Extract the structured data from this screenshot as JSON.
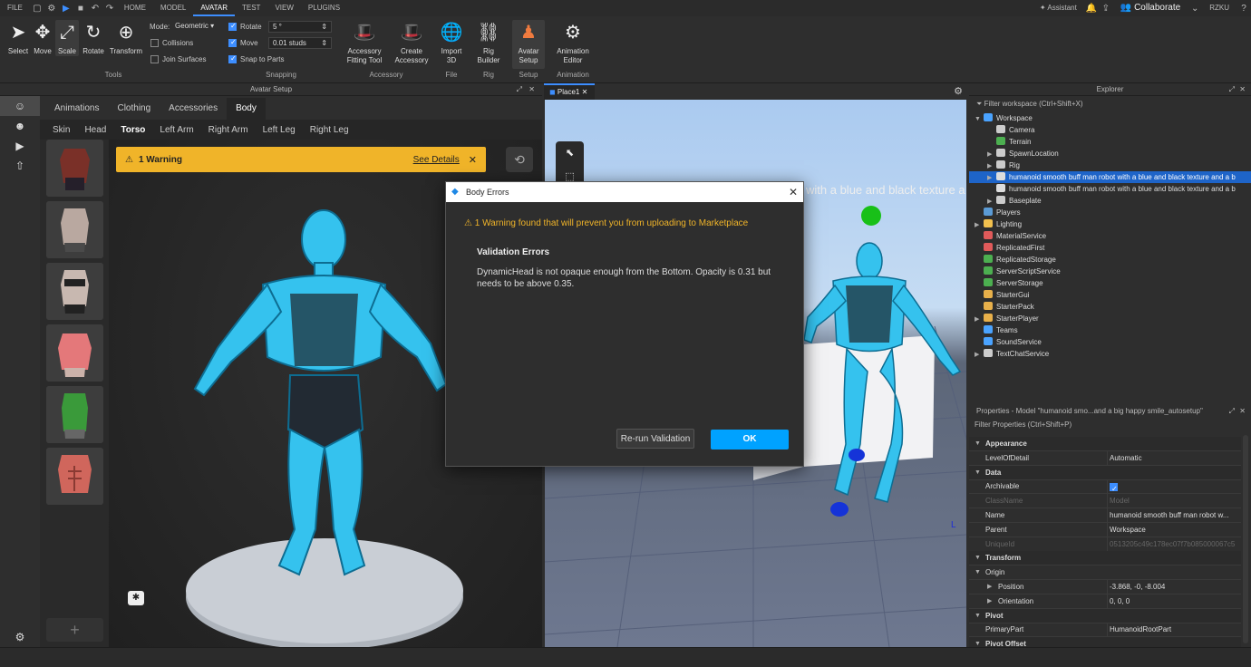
{
  "menu": {
    "file": "FILE",
    "tabs": [
      "HOME",
      "MODEL",
      "AVATAR",
      "TEST",
      "VIEW",
      "PLUGINS"
    ],
    "active_tab": "AVATAR",
    "assistant": "Assistant",
    "collaborate": "Collaborate",
    "user": "RZKU"
  },
  "ribbon": {
    "tools": {
      "select": "Select",
      "move": "Move",
      "scale": "Scale",
      "rotate": "Rotate",
      "transform": "Transform",
      "group": "Tools"
    },
    "mode_label": "Mode:",
    "mode_value": "Geometric",
    "collisions": "Collisions",
    "join_surfaces": "Join Surfaces",
    "rotate_label": "Rotate",
    "rotate_value": "5 °",
    "move_label": "Move",
    "move_value": "0.01 studs",
    "snap_to_parts": "Snap to Parts",
    "snapping_group": "Snapping",
    "accessory_fitting": [
      "Accessory",
      "Fitting Tool"
    ],
    "create_accessory": [
      "Create",
      "Accessory"
    ],
    "accessory_group": "Accessory",
    "import_3d": [
      "Import",
      "3D"
    ],
    "file_group": "File",
    "rig_builder": [
      "Rig",
      "Builder"
    ],
    "rig_group": "Rig",
    "avatar_setup": [
      "Avatar",
      "Setup"
    ],
    "setup_group": "Setup",
    "animation_editor": [
      "Animation",
      "Editor"
    ],
    "animation_group": "Animation"
  },
  "avatar_panel": {
    "title": "Avatar Setup",
    "tabs": [
      "Animations",
      "Clothing",
      "Accessories",
      "Body"
    ],
    "active_tab": "Body",
    "subtabs": [
      "Skin",
      "Head",
      "Torso",
      "Left Arm",
      "Right Arm",
      "Left Leg",
      "Right Leg"
    ],
    "active_subtab": "Torso",
    "warning": "1 Warning",
    "see_details": "See Details",
    "add": "+"
  },
  "viewport": {
    "tab": "Place1",
    "overlay_text": "with a blue and black texture a"
  },
  "dialog": {
    "title": "Body Errors",
    "warning": "1 Warning found that will prevent you from uploading to Marketplace",
    "heading": "Validation Errors",
    "message": "DynamicHead is not opaque enough from the Bottom. Opacity is 0.31 but needs to be above 0.35.",
    "rerun": "Re-run Validation",
    "ok": "OK"
  },
  "explorer": {
    "title": "Explorer",
    "filter": "Filter workspace (Ctrl+Shift+X)",
    "items": [
      {
        "label": "Workspace",
        "depth": 0,
        "arrow": "▼",
        "color": "#4aa3ff"
      },
      {
        "label": "Camera",
        "depth": 1,
        "arrow": "",
        "color": "#cccccc"
      },
      {
        "label": "Terrain",
        "depth": 1,
        "arrow": "",
        "color": "#4caf50"
      },
      {
        "label": "SpawnLocation",
        "depth": 1,
        "arrow": "▶",
        "color": "#cccccc"
      },
      {
        "label": "Rig",
        "depth": 1,
        "arrow": "▶",
        "color": "#cccccc"
      },
      {
        "label": "humanoid smooth buff man robot with a blue and black texture and a b",
        "depth": 1,
        "arrow": "▶",
        "color": "#dddddd",
        "selected": true
      },
      {
        "label": "humanoid smooth buff man robot with a blue and black texture and a b",
        "depth": 1,
        "arrow": "",
        "color": "#dddddd"
      },
      {
        "label": "Baseplate",
        "depth": 1,
        "arrow": "▶",
        "color": "#cccccc"
      },
      {
        "label": "Players",
        "depth": 0,
        "arrow": "",
        "color": "#5b9bd5"
      },
      {
        "label": "Lighting",
        "depth": 0,
        "arrow": "▶",
        "color": "#f2c14e"
      },
      {
        "label": "MaterialService",
        "depth": 0,
        "arrow": "",
        "color": "#e05a5a"
      },
      {
        "label": "ReplicatedFirst",
        "depth": 0,
        "arrow": "",
        "color": "#e05a5a"
      },
      {
        "label": "ReplicatedStorage",
        "depth": 0,
        "arrow": "",
        "color": "#4caf50"
      },
      {
        "label": "ServerScriptService",
        "depth": 0,
        "arrow": "",
        "color": "#4caf50"
      },
      {
        "label": "ServerStorage",
        "depth": 0,
        "arrow": "",
        "color": "#4caf50"
      },
      {
        "label": "StarterGui",
        "depth": 0,
        "arrow": "",
        "color": "#e8b04a"
      },
      {
        "label": "StarterPack",
        "depth": 0,
        "arrow": "",
        "color": "#e8b04a"
      },
      {
        "label": "StarterPlayer",
        "depth": 0,
        "arrow": "▶",
        "color": "#e8b04a"
      },
      {
        "label": "Teams",
        "depth": 0,
        "arrow": "",
        "color": "#4aa3ff"
      },
      {
        "label": "SoundService",
        "depth": 0,
        "arrow": "",
        "color": "#4aa3ff"
      },
      {
        "label": "TextChatService",
        "depth": 0,
        "arrow": "▶",
        "color": "#cccccc"
      }
    ]
  },
  "properties": {
    "title": "Properties - Model \"humanoid smo...and a big happy smile_autosetup\"",
    "filter": "Filter Properties (Ctrl+Shift+P)",
    "rows": [
      {
        "type": "header",
        "key": "Appearance"
      },
      {
        "key": "LevelOfDetail",
        "value": "Automatic"
      },
      {
        "type": "header",
        "key": "Data"
      },
      {
        "key": "Archivable",
        "value": "",
        "checkbox": true
      },
      {
        "key": "ClassName",
        "value": "Model",
        "dim": true
      },
      {
        "key": "Name",
        "value": "humanoid smooth buff man robot w..."
      },
      {
        "key": "Parent",
        "value": "Workspace"
      },
      {
        "key": "UniqueId",
        "value": "0513205c49c178ec07f7b085000067c5",
        "dim": true
      },
      {
        "type": "header",
        "key": "Transform"
      },
      {
        "type": "subheader",
        "key": "Origin"
      },
      {
        "key": "Position",
        "value": "-3.868, -0, -8.004",
        "indent": true
      },
      {
        "key": "Orientation",
        "value": "0, 0, 0",
        "indent": true
      },
      {
        "type": "header",
        "key": "Pivot"
      },
      {
        "key": "PrimaryPart",
        "value": "HumanoidRootPart"
      },
      {
        "type": "header",
        "key": "Pivot Offset"
      }
    ]
  },
  "colors": {
    "accent": "#3d8eff",
    "warning": "#f0b429",
    "robot": "#35c2ee",
    "ok_button": "#00a2ff"
  }
}
